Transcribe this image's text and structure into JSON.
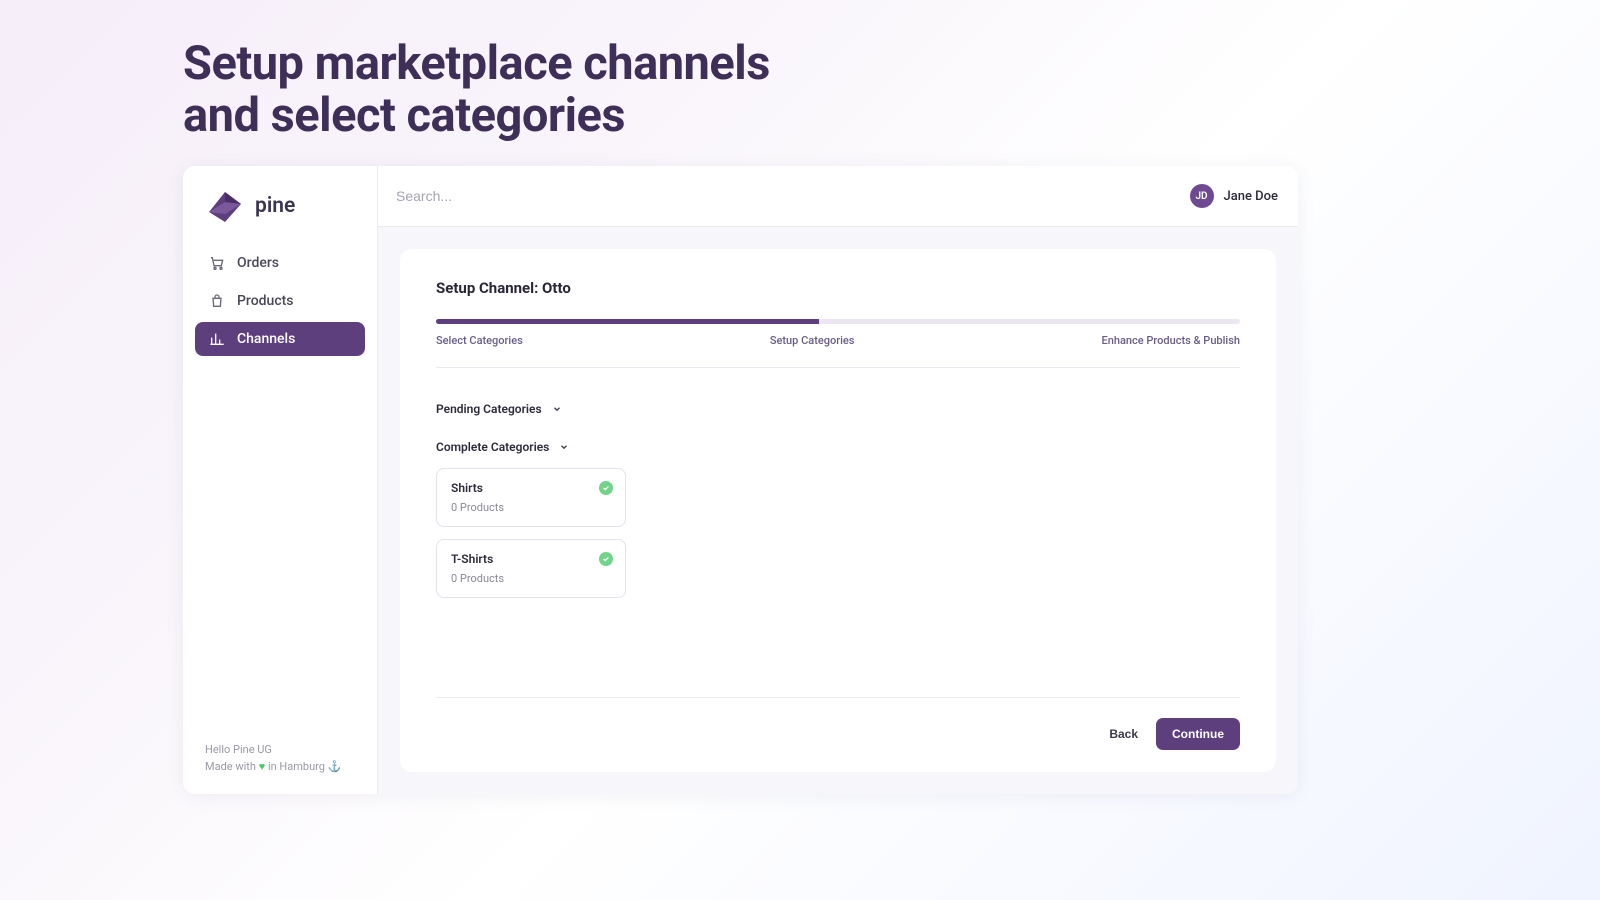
{
  "hero": {
    "line1": "Setup marketplace channels",
    "line2": "and select categories"
  },
  "brand": {
    "name": "pine"
  },
  "sidebar": {
    "items": [
      {
        "label": "Orders",
        "active": false
      },
      {
        "label": "Products",
        "active": false
      },
      {
        "label": "Channels",
        "active": true
      }
    ],
    "footer_line1": "Hello Pine UG",
    "footer_prefix": "Made with ",
    "footer_suffix": " in Hamburg ⚓"
  },
  "header": {
    "search_placeholder": "Search...",
    "user_initials": "JD",
    "user_name": "Jane Doe"
  },
  "card": {
    "title": "Setup Channel: Otto",
    "steps": {
      "a": "Select Categories",
      "b": "Setup Categories",
      "c": "Enhance Products & Publish"
    },
    "pending_label": "Pending Categories",
    "complete_label": "Complete Categories",
    "categories": [
      {
        "name": "Shirts",
        "sub": "0 Products"
      },
      {
        "name": "T-Shirts",
        "sub": "0 Products"
      }
    ],
    "back_label": "Back",
    "continue_label": "Continue"
  }
}
